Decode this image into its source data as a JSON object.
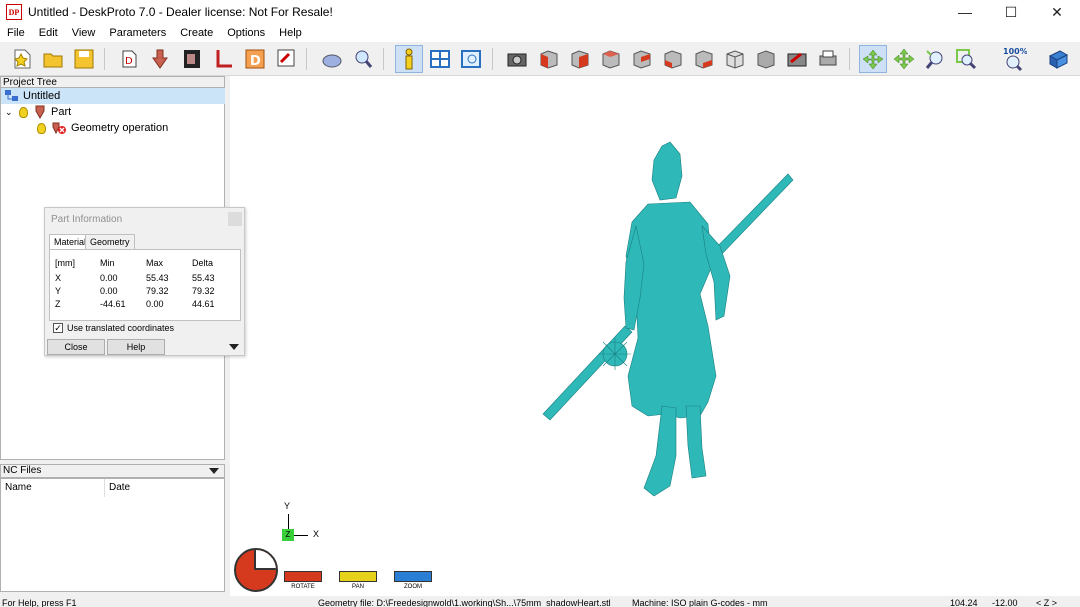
{
  "window": {
    "title": "Untitled - DeskProto 7.0 - Dealer license: Not For Resale!",
    "app_icon_text": "DP",
    "minimize_glyph": "—",
    "maximize_glyph": "☐",
    "close_glyph": "✕"
  },
  "menu": [
    "File",
    "Edit",
    "View",
    "Parameters",
    "Create",
    "Options",
    "Help"
  ],
  "toolbar": {
    "zoom_label": "100%",
    "icons": [
      "new-file-icon",
      "open-folder-icon",
      "save-icon",
      "import-geometry-icon",
      "toolpath-icon",
      "bitmap-icon",
      "vector-icon",
      "dxf-icon",
      "export-icon",
      "part-icon",
      "inspect-icon",
      "info-icon",
      "layout-icon",
      "preview-icon",
      "camera-icon",
      "view-front-icon",
      "view-back-icon",
      "view-left-icon",
      "view-right-icon",
      "view-top-icon",
      "view-bottom-icon",
      "view-iso-icon",
      "view-shaded-icon",
      "screenshot-icon",
      "print-icon",
      "rotate-icon",
      "pan-icon",
      "zoom-in-icon",
      "zoom-window-icon",
      "zoom-100-icon",
      "book-icon"
    ]
  },
  "project_tree": {
    "header": "Project Tree",
    "items": [
      {
        "label": "Untitled"
      },
      {
        "label": "Part"
      },
      {
        "label": "Geometry operation"
      }
    ]
  },
  "nc_files": {
    "header": "NC Files",
    "columns": [
      "Name",
      "Date"
    ]
  },
  "part_info": {
    "title": "Part Information",
    "tabs": [
      "Material",
      "Geometry"
    ],
    "headers": [
      "[mm]",
      "Min",
      "Max",
      "Delta"
    ],
    "rows": [
      {
        "axis": "X",
        "min": "0.00",
        "max": "55.43",
        "delta": "55.43"
      },
      {
        "axis": "Y",
        "min": "0.00",
        "max": "79.32",
        "delta": "79.32"
      },
      {
        "axis": "Z",
        "min": "-44.61",
        "max": "0.00",
        "delta": "44.61"
      }
    ],
    "checkbox_label": "Use translated coordinates",
    "checkbox_mark": "✓",
    "close_label": "Close",
    "help_label": "Help"
  },
  "axes": {
    "y": "Y",
    "x": "X",
    "z": "Z"
  },
  "view_modes": [
    "ROTATE",
    "PAN",
    "ZOOM"
  ],
  "colors": {
    "model": "#2fb8b8",
    "rotate": "#d63a1e",
    "pan": "#e6d21a",
    "zoom": "#2a7fd4"
  },
  "status": {
    "help": "For Help, press F1",
    "geometry_file": "Geometry file: D:\\Freedesignwold\\1.working\\Sh...\\75mm_shadowHeart.stl",
    "machine": "Machine: ISO plain G-codes - mm",
    "coord_1": "104.24",
    "coord_2": "-12.00",
    "axis_view": "< Z >"
  }
}
